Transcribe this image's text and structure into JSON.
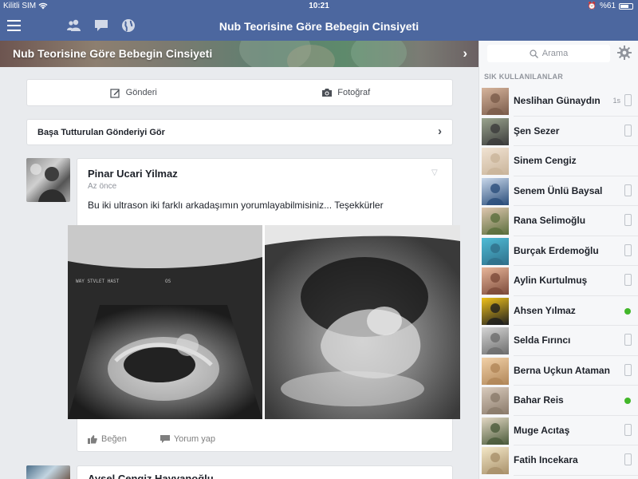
{
  "status_bar": {
    "carrier": "Kilitli SIM",
    "time": "10:21",
    "battery": "%61"
  },
  "nav": {
    "title": "Nub Teorisine Göre Bebegin Cinsiyeti",
    "icons": [
      "friends-icon",
      "messages-icon",
      "globe-icon"
    ]
  },
  "group": {
    "title": "Nub Teorisine Göre Bebegin Cinsiyeti"
  },
  "composer": {
    "post_label": "Gönderi",
    "photo_label": "Fotoğraf"
  },
  "pinned": {
    "label": "Başa Tutturulan Gönderiyi Gör"
  },
  "post": {
    "author": "Pinar Ucari Yilmaz",
    "time": "Az önce",
    "text": "Bu iki ultrason iki farklı arkadaşımın yorumlayabilmisiniz... Teşekkürler",
    "like_label": "Beğen",
    "comment_label": "Yorum yap"
  },
  "post2": {
    "author": "Aysel Cengiz Hayvanoğlu"
  },
  "sidebar": {
    "search_placeholder": "Arama",
    "section_title": "SIK KULLANILANLAR",
    "contacts": [
      {
        "name": "Neslihan Günaydın",
        "status": "mobile",
        "time": "1s"
      },
      {
        "name": "Şen Sezer",
        "status": "mobile"
      },
      {
        "name": "Sinem Cengiz",
        "status": "none"
      },
      {
        "name": "Senem Ünlü Baysal",
        "status": "mobile"
      },
      {
        "name": "Rana Selimoğlu",
        "status": "mobile"
      },
      {
        "name": "Burçak Erdemoğlu",
        "status": "mobile"
      },
      {
        "name": "Aylin Kurtulmuş",
        "status": "mobile"
      },
      {
        "name": "Ahsen Yılmaz",
        "status": "online"
      },
      {
        "name": "Selda Fırıncı",
        "status": "mobile"
      },
      {
        "name": "Berna Uçkun Ataman",
        "status": "mobile"
      },
      {
        "name": "Bahar Reis",
        "status": "online"
      },
      {
        "name": "Muge Acıtaş",
        "status": "mobile"
      },
      {
        "name": "Fatih Incekara",
        "status": "mobile"
      }
    ]
  },
  "colors": {
    "nav_blue": "#4c679f",
    "online_green": "#42b72a",
    "background": "#e9ebee"
  }
}
